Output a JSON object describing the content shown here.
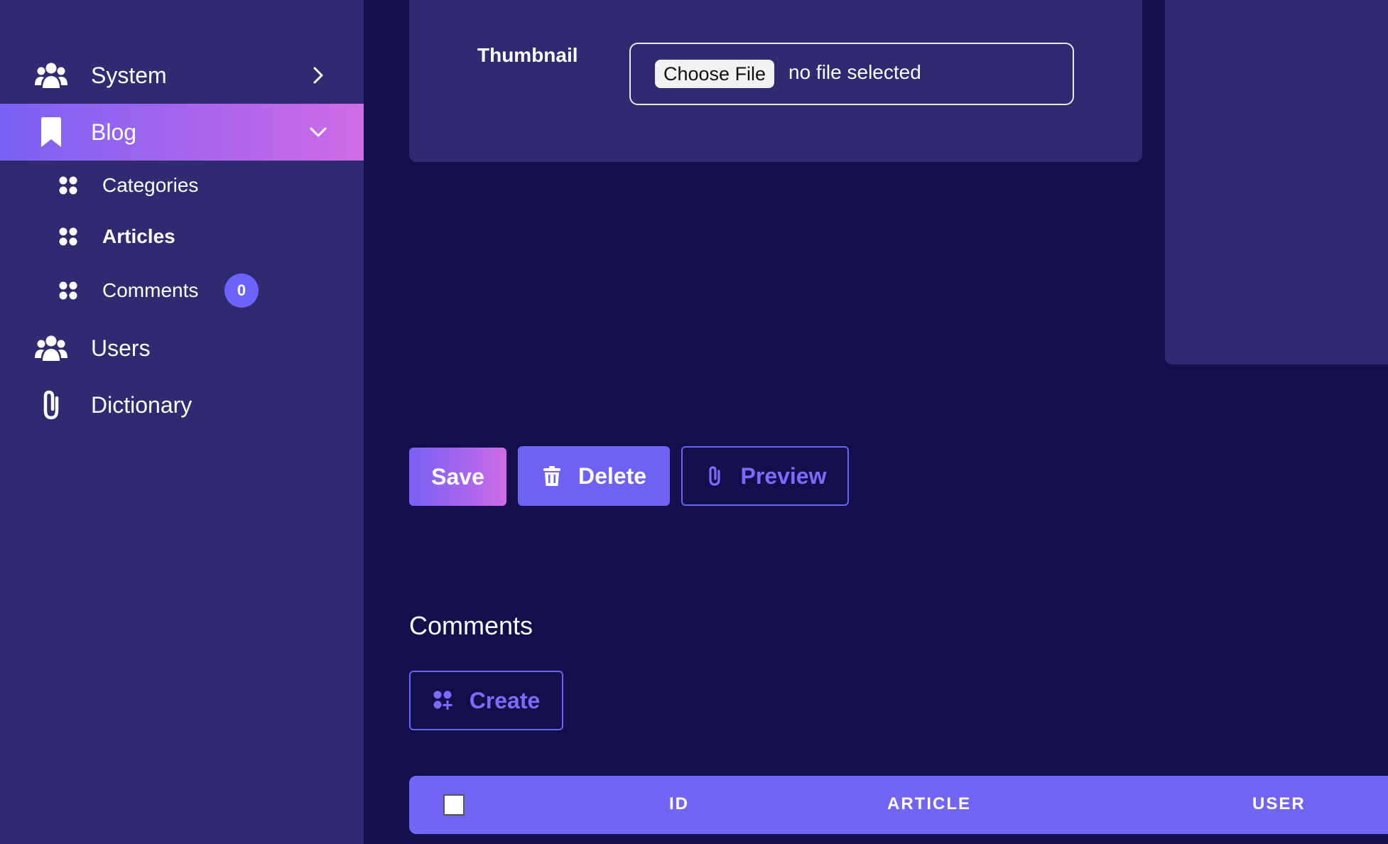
{
  "sidebar": {
    "items": [
      {
        "label": "System",
        "icon": "users-icon",
        "chevron": "chevron-right-icon"
      },
      {
        "label": "Blog",
        "icon": "bookmark-icon",
        "chevron": "chevron-down-icon",
        "active": true
      },
      {
        "label": "Users",
        "icon": "users-icon"
      },
      {
        "label": "Dictionary",
        "icon": "paperclip-icon"
      }
    ],
    "blog_subitems": [
      {
        "label": "Categories",
        "icon": "grid-icon"
      },
      {
        "label": "Articles",
        "icon": "grid-icon",
        "current": true
      },
      {
        "label": "Comments",
        "icon": "grid-icon",
        "badge": "0"
      }
    ]
  },
  "form": {
    "thumbnail_label": "Thumbnail",
    "file_button": "Choose File",
    "file_status": "no file selected"
  },
  "actions": {
    "save_label": "Save",
    "delete_label": "Delete",
    "preview_label": "Preview"
  },
  "comments": {
    "title": "Comments",
    "create_label": "Create",
    "table": {
      "columns": [
        "ID",
        "ARTICLE",
        "USER"
      ]
    }
  },
  "colors": {
    "background": "#120f4b",
    "panel": "#302b70",
    "accent": "#6d62f2",
    "gradient_start": "#7a62f4",
    "gradient_end": "#d06ce6"
  }
}
